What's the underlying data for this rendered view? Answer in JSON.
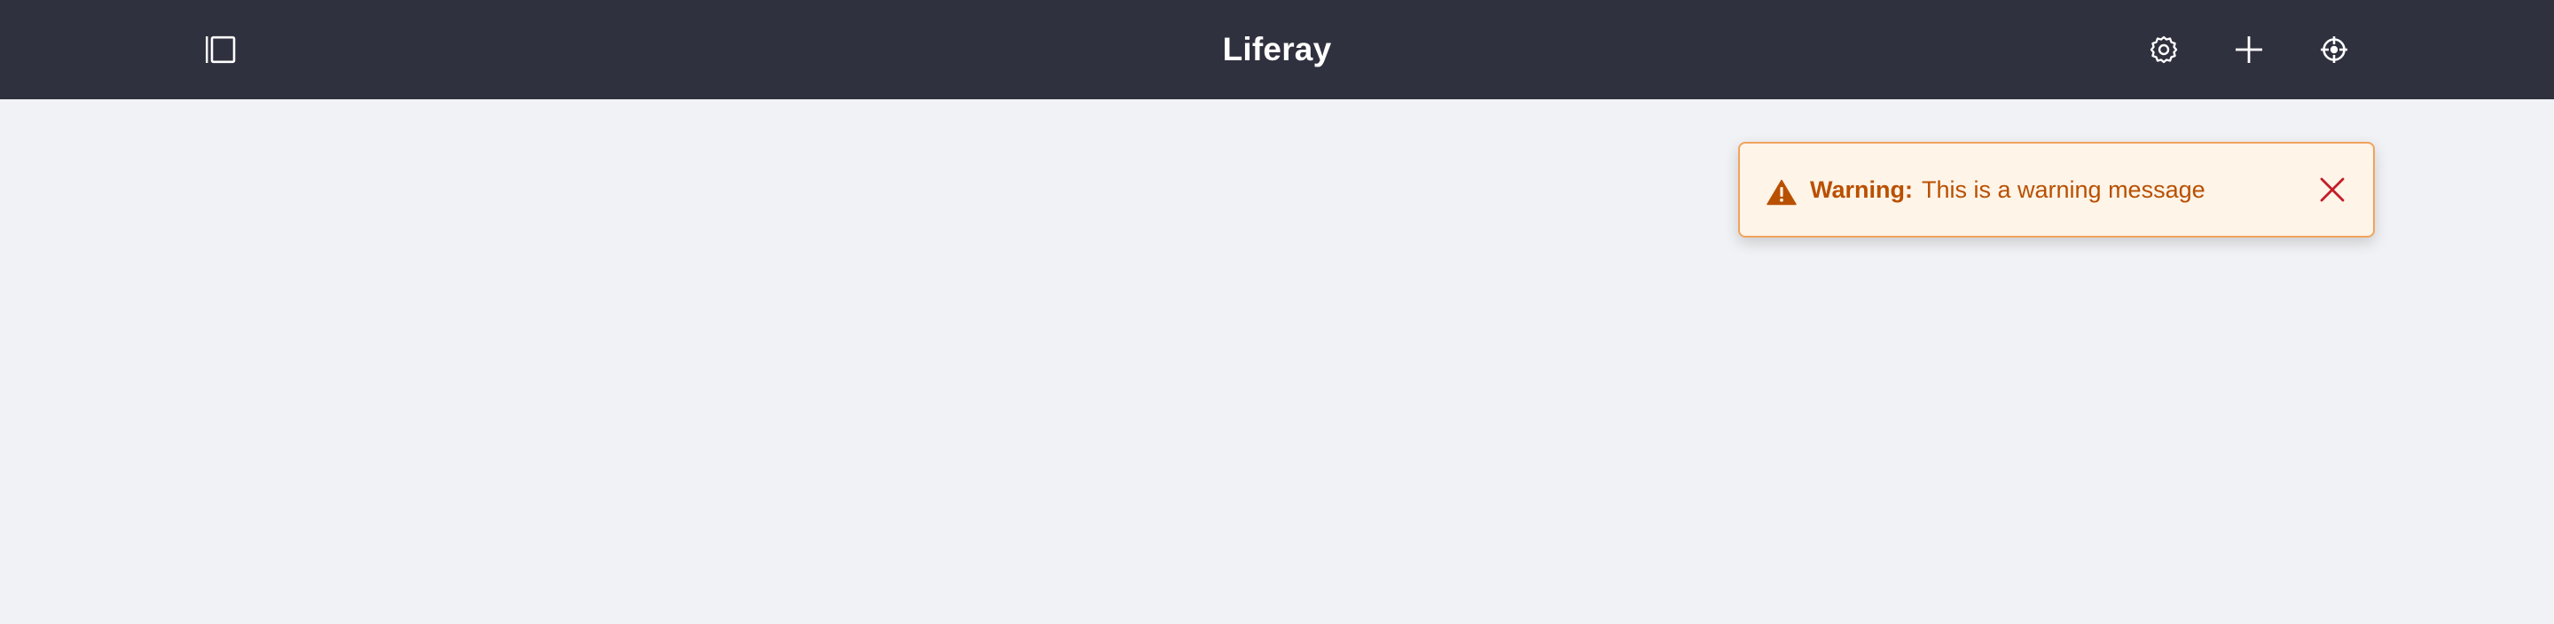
{
  "header": {
    "title": "Liferay",
    "background_color": "#30313f",
    "left_icons": [
      "sidebar-toggle-icon"
    ],
    "right_icons": [
      "gear-icon",
      "plus-icon",
      "simulation-target-icon"
    ]
  },
  "alert": {
    "type": "warning",
    "lead": "Warning:",
    "message": "This is a warning message",
    "icon": "warning-triangle-icon",
    "close_icon": "close-icon",
    "colors": {
      "background": "#fef4e8",
      "border": "#f0a35d",
      "text": "#b95000",
      "close": "#c31d2a"
    }
  },
  "page": {
    "background_color": "#f1f2f5"
  }
}
